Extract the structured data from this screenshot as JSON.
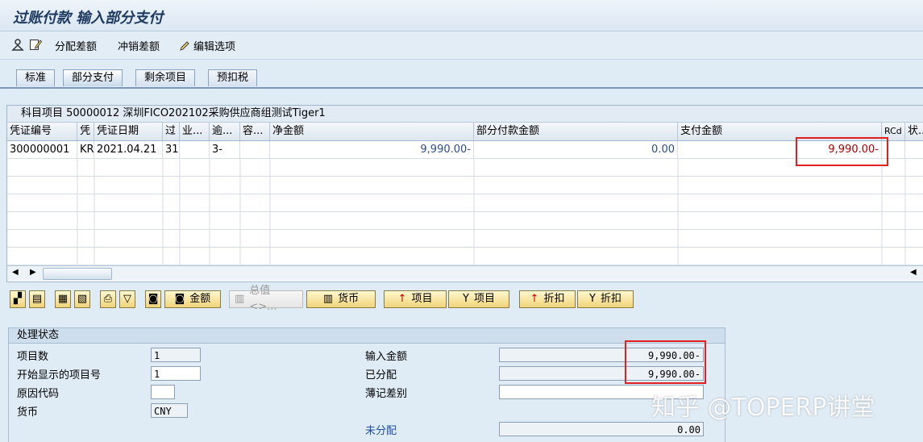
{
  "window": {
    "title": "过账付款 输入部分支付"
  },
  "toolbar": {
    "distribute_label": "分配差额",
    "writeoff_label": "冲销差额",
    "edit_label": "编辑选项"
  },
  "tabs": [
    {
      "label": "标准"
    },
    {
      "label": "部分支付"
    },
    {
      "label": "剩余项目"
    },
    {
      "label": "预扣税"
    }
  ],
  "panel": {
    "header": "科目项目 50000012 深圳FICO202102采购供应商组测试Tiger1",
    "columns": [
      "凭证编号",
      "凭",
      "凭证日期",
      "过",
      "业...",
      "逾...",
      "容...",
      "净金额",
      "部分付款金额",
      "支付金额",
      "RCd",
      "状..."
    ],
    "rows": [
      {
        "doc_no": "300000001",
        "type": "KR",
        "date": "2021.04.21",
        "post": "31",
        "biz": "",
        "overdue": "3-",
        "tol": "",
        "net": "9,990.00-",
        "partial": "0.00",
        "payment": "9,990.00-",
        "rcd": "",
        "status": ""
      }
    ]
  },
  "buttons": {
    "amount": "金额",
    "total": "总值<>...",
    "currency": "货币",
    "items1": "项目",
    "items2": "项目",
    "discount1": "折扣",
    "discount2": "折扣"
  },
  "status": {
    "header": "处理状态",
    "item_count_label": "项目数",
    "item_count": "1",
    "start_item_label": "开始显示的项目号",
    "start_item": "1",
    "reason_label": "原因代码",
    "reason": "",
    "currency_label": "货币",
    "currency": "CNY",
    "entered_label": "输入金额",
    "entered": "9,990.00-",
    "assigned_label": "已分配",
    "assigned": "9,990.00-",
    "diff_label": "薄记差别",
    "diff": "",
    "unassigned_label": "未分配",
    "unassigned": "0.00"
  },
  "watermark": "知乎 @TOPERP讲堂"
}
